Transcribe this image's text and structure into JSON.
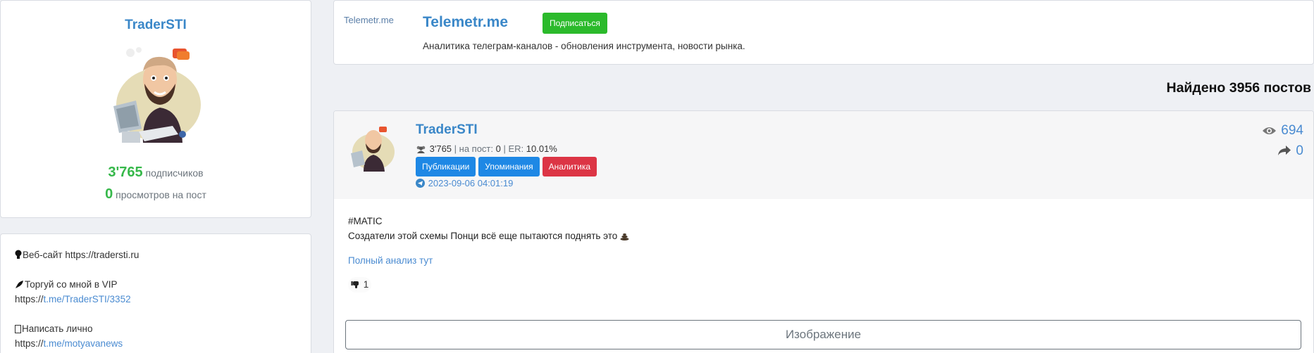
{
  "profile": {
    "name": "TraderSTI",
    "subscribers_count": "3'765",
    "subscribers_label": "подписчиков",
    "views_count": "0",
    "views_label": "просмотров на пост"
  },
  "bio": {
    "lines": [
      {
        "icon": "bulb-icon",
        "text": "Веб-сайт https://tradersti.ru"
      },
      {
        "icon": "rocket-icon",
        "text": "Торгуй со мной в VIP"
      },
      {
        "prefix": "https://",
        "link": "t.me/TraderSTI/3352"
      },
      {
        "icon": "message-icon",
        "text": "Написать лично"
      },
      {
        "prefix": "https://",
        "link": "t.me/motyavanews"
      }
    ]
  },
  "channel": {
    "image_alt": "Telemetr.me",
    "title": "Telemetr.me",
    "subscribe_label": "Подписаться",
    "description": "Аналитика телеграм-каналов - обновления инструмента, новости рынка."
  },
  "found_heading": "Найдено 3956 постов",
  "post": {
    "author": "TraderSTI",
    "subs": "3'765",
    "per_post_label": "на пост:",
    "per_post": "0",
    "er_label": "ER:",
    "er": "10.01%",
    "buttons": {
      "publications": "Публикации",
      "mentions": "Упоминания",
      "analytics": "Аналитика"
    },
    "date": "2023-09-06 04:01:19",
    "views": "694",
    "shares": "0",
    "tag": "#MATIC",
    "text": "Создатели этой схемы Понци всё еще пытаются поднять это",
    "link": "Полный анализ тут",
    "reaction_count": "1",
    "image_button": "Изображение"
  },
  "colors": {
    "accent_blue": "#3a87c8",
    "button_blue": "#1e88e5",
    "button_red": "#dc3545",
    "subscribe_green": "#2bba2b",
    "count_green": "#36b84a"
  }
}
